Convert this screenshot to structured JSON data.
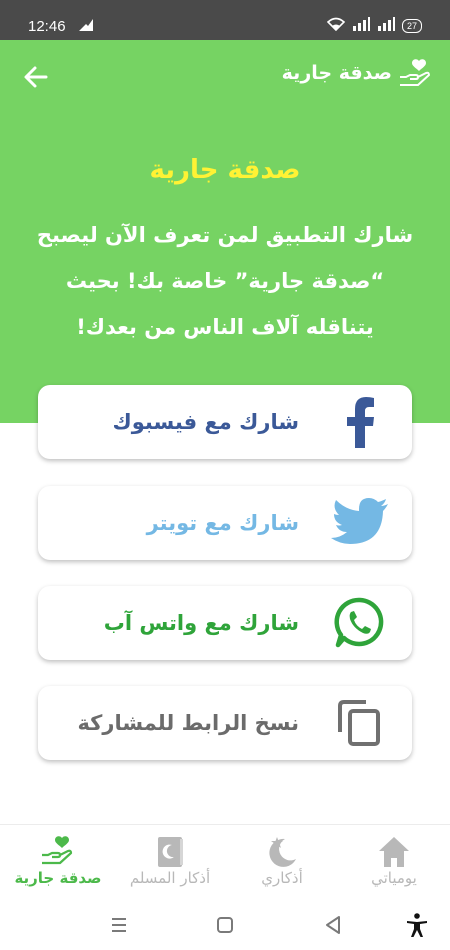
{
  "status": {
    "time": "12:46",
    "battery": "27"
  },
  "header": {
    "title": "صدقة جارية"
  },
  "hero": {
    "heading": "صدقة جارية",
    "text": "شارك التطبيق لمن تعرف الآن ليصبح\n“صدقة جارية” خاصة بك! بحيث\nيتناقله آلاف الناس من بعدك!"
  },
  "share": {
    "facebook": {
      "label": "شارك مع فيسبوك",
      "icon": "facebook-icon",
      "color": "#3b5998"
    },
    "twitter": {
      "label": "شارك مع تويتر",
      "icon": "twitter-icon",
      "color": "#74b8e4"
    },
    "whatsapp": {
      "label": "شارك مع واتس آب",
      "icon": "whatsapp-icon",
      "color": "#2fa43a"
    },
    "copy": {
      "label": "نسخ الرابط للمشاركة",
      "icon": "copy-icon",
      "color": "#6b6b6b"
    }
  },
  "nav": {
    "items": [
      {
        "label": "يومياتي",
        "icon": "home-icon",
        "active": false
      },
      {
        "label": "أذكاري",
        "icon": "crescent-star-icon",
        "active": false
      },
      {
        "label": "أذكار المسلم",
        "icon": "book-icon",
        "active": false
      },
      {
        "label": "صدقة جارية",
        "icon": "charity-heart-icon",
        "active": true
      }
    ],
    "active_color": "#4cb94a",
    "inactive_color": "#b8b8b8"
  },
  "colors": {
    "primary": "#76d363",
    "heading": "#fff234"
  }
}
